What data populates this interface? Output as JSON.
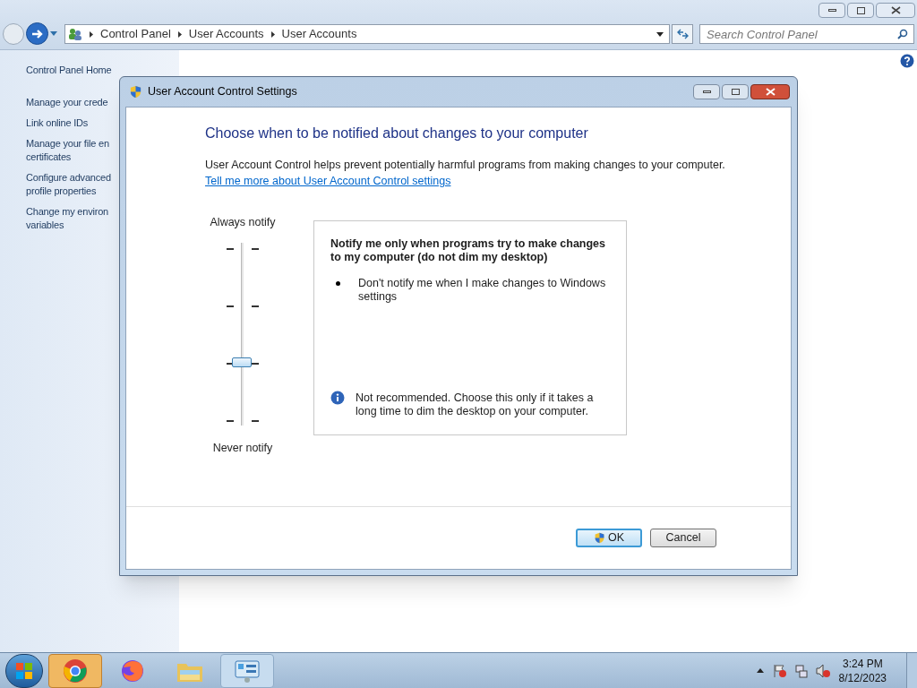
{
  "explorer": {
    "breadcrumbs": [
      "Control Panel",
      "User Accounts",
      "User Accounts"
    ],
    "search": {
      "placeholder": "Search Control Panel"
    },
    "sidebar": [
      {
        "label": "Control Panel Home",
        "kind": "home"
      },
      {
        "label": "Manage your crede",
        "kind": "link"
      },
      {
        "label": "Link online IDs",
        "kind": "link"
      },
      {
        "label": "Manage your file en\ncertificates",
        "kind": "link"
      },
      {
        "label": "Configure advanced\nprofile properties",
        "kind": "link"
      },
      {
        "label": "Change my environ\nvariables",
        "kind": "link"
      }
    ]
  },
  "dialog": {
    "title": "User Account Control Settings",
    "heading": "Choose when to be notified about changes to your computer",
    "description": "User Account Control helps prevent potentially harmful programs from making changes to your computer.",
    "link": "Tell me more about User Account Control settings",
    "slider": {
      "top_label": "Always notify",
      "bottom_label": "Never notify",
      "level": 0.3333
    },
    "info": {
      "title": "Notify me only when programs try to make changes to my computer (do not dim my desktop)",
      "bullets": [
        "Don't notify me when I make changes to Windows settings"
      ],
      "note": "Not recommended. Choose this only if it takes a long time to dim the desktop on your computer."
    },
    "buttons": [
      {
        "label": "OK",
        "kind": "shield",
        "selected": true
      },
      {
        "label": "Cancel",
        "kind": "plain",
        "selected": false
      }
    ]
  },
  "taskbar": {
    "apps": [
      {
        "kind": "chrome",
        "selected": true
      },
      {
        "kind": "firefox",
        "selected": false
      },
      {
        "kind": "folder",
        "selected": false
      },
      {
        "kind": "control-panel",
        "selected": true
      }
    ],
    "time": "3:24 PM",
    "date": "8/12/2023"
  }
}
